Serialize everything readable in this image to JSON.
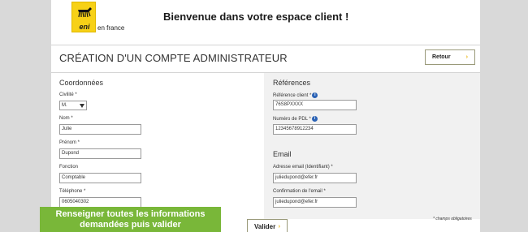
{
  "header": {
    "logo_text": "eni",
    "subtitle": "en france",
    "welcome": "Bienvenue dans votre espace client !"
  },
  "title_bar": {
    "title": "CRÉATION D'UN COMPTE ADMINISTRATEUR",
    "back_button": "Retour",
    "arrow": "›"
  },
  "coordonnees": {
    "heading": "Coordonnées",
    "civilite_label": "Civilité *",
    "civilite_value": "M.",
    "nom_label": "Nom *",
    "nom_value": "Julie",
    "prenom_label": "Prénom *",
    "prenom_value": "Dupond",
    "fonction_label": "Fonction",
    "fonction_value": "Comptable",
    "telephone_label": "Téléphone *",
    "telephone_value": "0605040302"
  },
  "references": {
    "heading": "Références",
    "ref_client_label": "Référence client *",
    "ref_client_value": "76S8PXXXX",
    "pdl_label": "Numéro de PDL *",
    "pdl_value": "12345678912234",
    "info": "i"
  },
  "email": {
    "heading": "Email",
    "address_label": "Adresse email (Identifiant) *",
    "address_value": "juliedupond@efer.fr",
    "confirm_label": "Confirmation de l'email *",
    "confirm_value": "juliedupond@efer.fr"
  },
  "footer": {
    "required_note": "* champs obligatoires",
    "submit_button": "Valider"
  },
  "banner": {
    "line1": "Renseigner toutes les informations",
    "line2": "demandées puis valider"
  },
  "colors": {
    "banner_green": "#79b739",
    "logo_yellow": "#f7d117",
    "info_blue": "#2a62b5",
    "button_arrow": "#e8b000"
  }
}
